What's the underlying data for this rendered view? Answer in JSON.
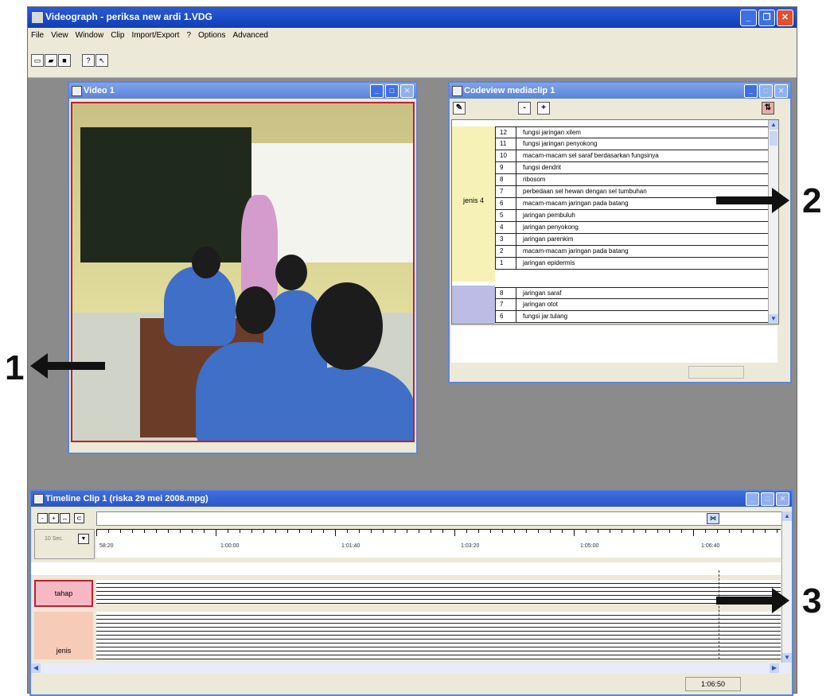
{
  "app": {
    "title": "Videograph - periksa new ardi 1.VDG"
  },
  "menu": [
    "File",
    "View",
    "Window",
    "Clip",
    "Import/Export",
    "?",
    "Options",
    "Advanced"
  ],
  "video": {
    "title": "Video 1"
  },
  "codeview": {
    "title": "Codeview mediaclip 1",
    "group1_label": "jenis 4",
    "rows1": [
      {
        "n": "12",
        "label": "fungsi jaringan xilem"
      },
      {
        "n": "11",
        "label": "fungsi jaringan penyokong"
      },
      {
        "n": "10",
        "label": "macam-macam sel saraf berdasarkan fungsinya"
      },
      {
        "n": "9",
        "label": "fungsi dendrit"
      },
      {
        "n": "8",
        "label": "ribosom"
      },
      {
        "n": "7",
        "label": "perbedaan sel hewan dengan sel tumbuhan"
      },
      {
        "n": "6",
        "label": "macam-macam jaringan pada batang"
      },
      {
        "n": "5",
        "label": "jaringan pembuluh"
      },
      {
        "n": "4",
        "label": "jaringan penyokong"
      },
      {
        "n": "3",
        "label": "jaringan parenkim"
      },
      {
        "n": "2",
        "label": "macam-macam jaringan pada batang"
      },
      {
        "n": "1",
        "label": "jaringan epidermis"
      }
    ],
    "rows2": [
      {
        "n": "8",
        "label": "jaringan saraf"
      },
      {
        "n": "7",
        "label": "jaringan otot"
      },
      {
        "n": "6",
        "label": "fungsi jar.tulang"
      }
    ]
  },
  "timeline": {
    "title": "Timeline Clip 1 (riska 29 mei 2008.mpg)",
    "interval": "10 Sec.",
    "ticks": [
      "58:20",
      "1:00:00",
      "1:01:40",
      "1:03:20",
      "1:05:00",
      "1:06:40"
    ],
    "track_tahap": "tahap",
    "track_jenis": "jenis",
    "current_time": "1:06:50"
  },
  "annotations": [
    "1",
    "2",
    "3"
  ]
}
